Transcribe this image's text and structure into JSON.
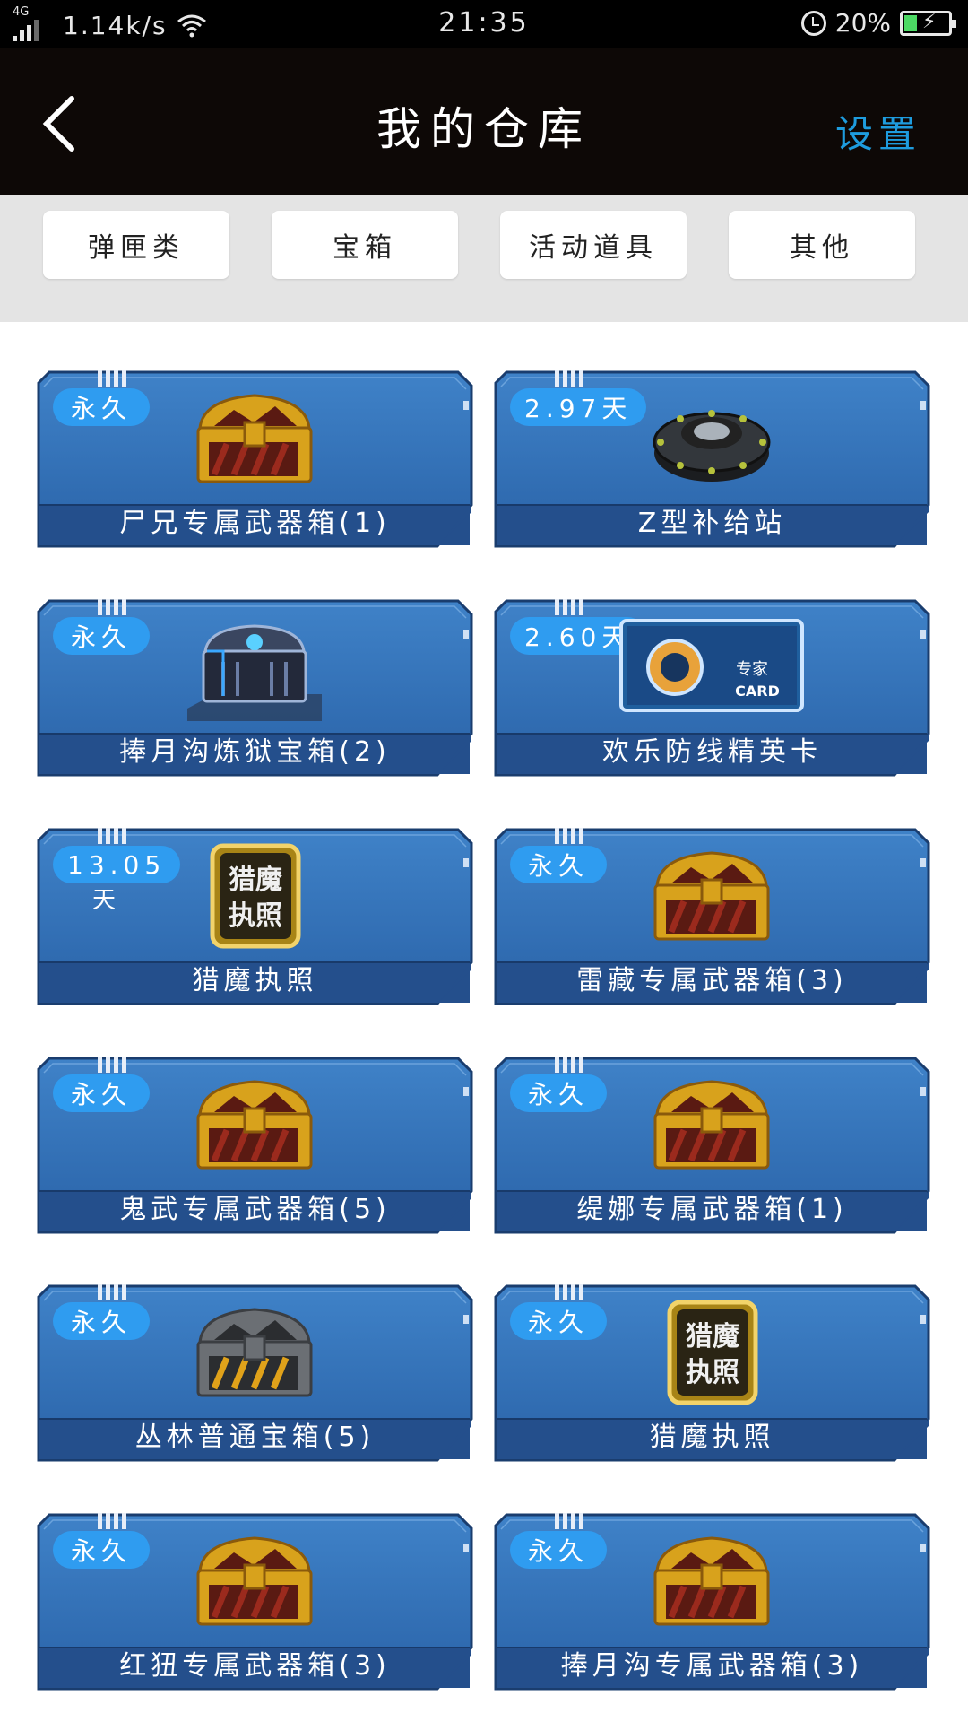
{
  "status_bar": {
    "network": "4G",
    "speed": "1.14k/s",
    "time": "21:35",
    "battery": "20%"
  },
  "header": {
    "title": "我的仓库",
    "settings_label": "设置"
  },
  "tabs": [
    "弹匣类",
    "宝箱",
    "活动道具",
    "其他"
  ],
  "items": [
    {
      "badge": "永久",
      "name": "尸兄专属武器箱(1)",
      "icon": "gold-chest-icon"
    },
    {
      "badge": "2.97天",
      "name": "Z型补给站",
      "icon": "supply-station-icon"
    },
    {
      "badge": "永久",
      "name": "捧月沟炼狱宝箱(2)",
      "icon": "steel-chest-icon"
    },
    {
      "badge": "2.60天",
      "name": "欢乐防线精英卡",
      "icon": "elite-card-icon",
      "card_text": "专家",
      "card_sub": "CARD"
    },
    {
      "badge": "13.05",
      "badge_sub": "天",
      "name": "猎魔执照",
      "icon": "license-icon",
      "license_text": [
        "猎魔",
        "执照"
      ]
    },
    {
      "badge": "永久",
      "name": "雷藏专属武器箱(3)",
      "icon": "gold-chest-icon"
    },
    {
      "badge": "永久",
      "name": "鬼武专属武器箱(5)",
      "icon": "gold-chest-icon"
    },
    {
      "badge": "永久",
      "name": "缇娜专属武器箱(1)",
      "icon": "gold-chest-icon"
    },
    {
      "badge": "永久",
      "name": "丛林普通宝箱(5)",
      "icon": "gray-chest-icon"
    },
    {
      "badge": "永久",
      "name": "猎魔执照",
      "icon": "license-icon",
      "license_text": [
        "猎魔",
        "执照"
      ]
    },
    {
      "badge": "永久",
      "name": "红狃专属武器箱(3)",
      "icon": "gold-chest-icon"
    },
    {
      "badge": "永久",
      "name": "捧月沟专属武器箱(3)",
      "icon": "gold-chest-icon"
    }
  ],
  "colors": {
    "header_bg": "#0d0806",
    "accent": "#1e9cde",
    "card_blue": "#2f6fb8",
    "badge_blue": "#2f9cf0"
  }
}
